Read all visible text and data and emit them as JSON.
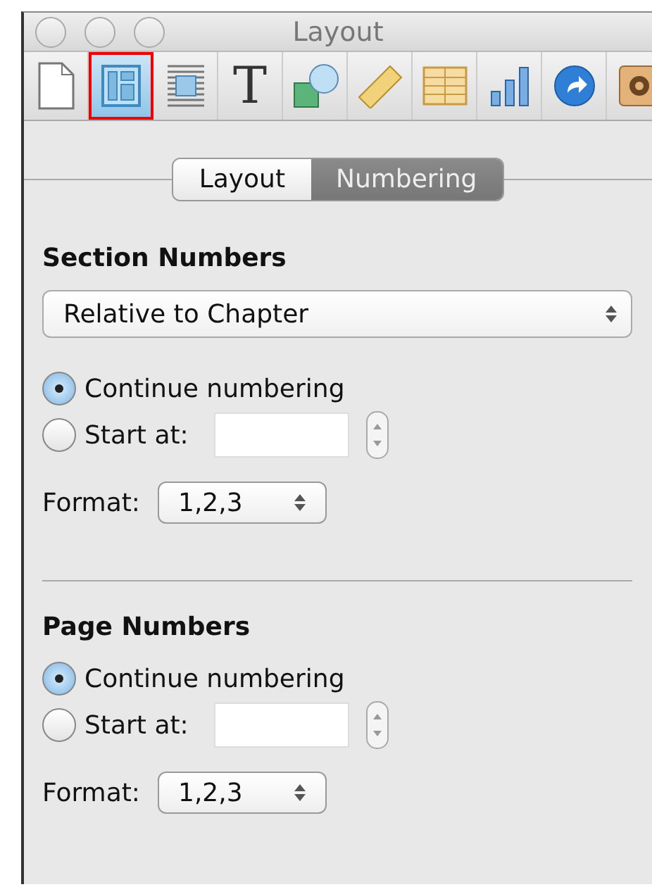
{
  "window": {
    "title": "Layout"
  },
  "toolbar": [
    {
      "kind": "document",
      "selected": false
    },
    {
      "kind": "layout",
      "selected": true
    },
    {
      "kind": "wrap",
      "selected": false
    },
    {
      "kind": "text",
      "glyph": "T",
      "selected": false
    },
    {
      "kind": "shapes",
      "selected": false
    },
    {
      "kind": "ruler",
      "selected": false
    },
    {
      "kind": "table",
      "selected": false
    },
    {
      "kind": "chart",
      "selected": false
    },
    {
      "kind": "link",
      "selected": false
    },
    {
      "kind": "settings",
      "selected": false
    }
  ],
  "tabs": [
    {
      "label": "Layout",
      "selected": false
    },
    {
      "label": "Numbering",
      "selected": true
    }
  ],
  "sections": [
    {
      "title": "Section Numbers",
      "dropdown": "Relative to Chapter",
      "options": [
        {
          "label": "Continue numbering",
          "selected": true,
          "kind": "plain"
        },
        {
          "label": "Start at:",
          "selected": false,
          "kind": "stepper"
        }
      ],
      "format_label": "Format:",
      "format": "1,2,3"
    },
    {
      "title": "Page Numbers",
      "options": [
        {
          "label": "Continue numbering",
          "selected": true,
          "kind": "plain"
        },
        {
          "label": "Start at:",
          "selected": false,
          "kind": "stepper"
        }
      ],
      "format_label": "Format:",
      "format": "1,2,3"
    }
  ]
}
